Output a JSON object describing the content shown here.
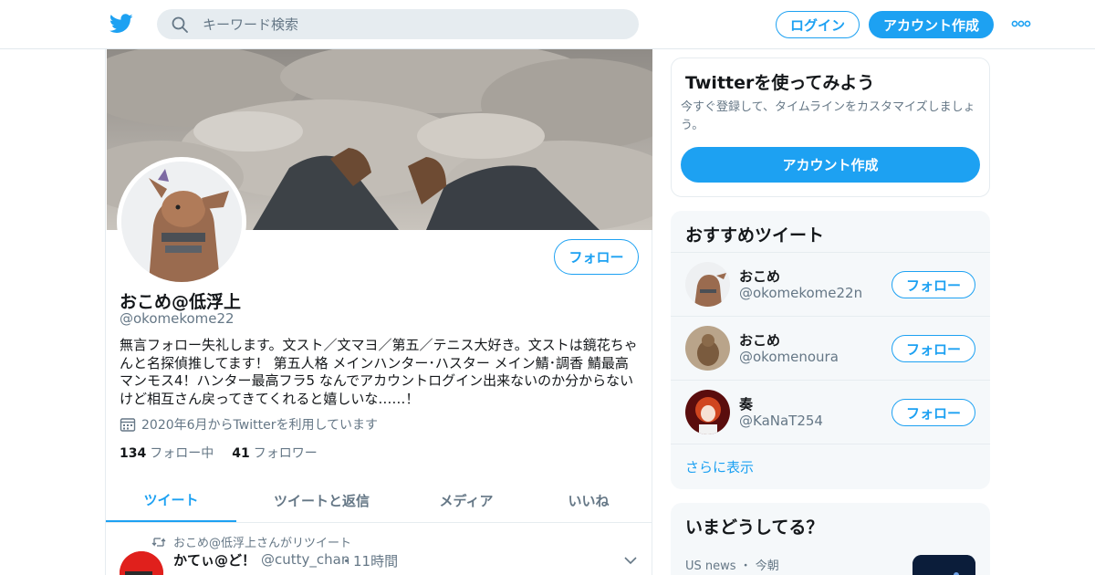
{
  "header": {
    "search_placeholder": "キーワード検索",
    "login_label": "ログイン",
    "signup_label": "アカウント作成"
  },
  "profile": {
    "name": "おこめ@低浮上",
    "handle": "@okomekome22",
    "follow_label": "フォロー",
    "bio": "無言フォロー失礼します。文スト／文マヨ／第五／テニス大好き。文ストは鏡花ちゃんと名探偵推してます！ 第五人格 メインハンター･ハスター メイン鯖･調香 鯖最高マンモス4！ハンター最高フラ5 なんでアカウントログイン出来ないのか分からないけど相互さん戻ってきてくれると嬉しいな……！",
    "joined": "2020年6月からTwitterを利用しています",
    "following_count": "134",
    "following_label": "フォロー中",
    "followers_count": "41",
    "followers_label": "フォロワー"
  },
  "tabs": [
    {
      "label": "ツイート"
    },
    {
      "label": "ツイートと返信"
    },
    {
      "label": "メディア"
    },
    {
      "label": "いいね"
    }
  ],
  "tweet": {
    "retweet_note": "おこめ@低浮上さんがリツイート",
    "author_name": "かてぃ@ど！",
    "author_handle": "@cutty_chan",
    "time": "・11時間"
  },
  "sidebar": {
    "signup_card": {
      "title": "Twitterを使ってみよう",
      "desc": "今すぐ登録して、タイムラインをカスタマイズしましょう。",
      "button": "アカウント作成"
    },
    "recommended": {
      "title": "おすすめツイート",
      "users": [
        {
          "name": "おこめ",
          "handle": "@okomekome22n",
          "follow": "フォロー"
        },
        {
          "name": "おこめ",
          "handle": "@okomenoura",
          "follow": "フォロー"
        },
        {
          "name": "奏",
          "handle": "@KaNaT254",
          "follow": "フォロー"
        }
      ],
      "more": "さらに表示"
    },
    "trends": {
      "title": "いまどうしてる？",
      "meta": "US news ・ 今朝"
    }
  },
  "colors": {
    "accent": "#1da1f2",
    "secondary_text": "#657786",
    "border": "#e6ecf0"
  }
}
